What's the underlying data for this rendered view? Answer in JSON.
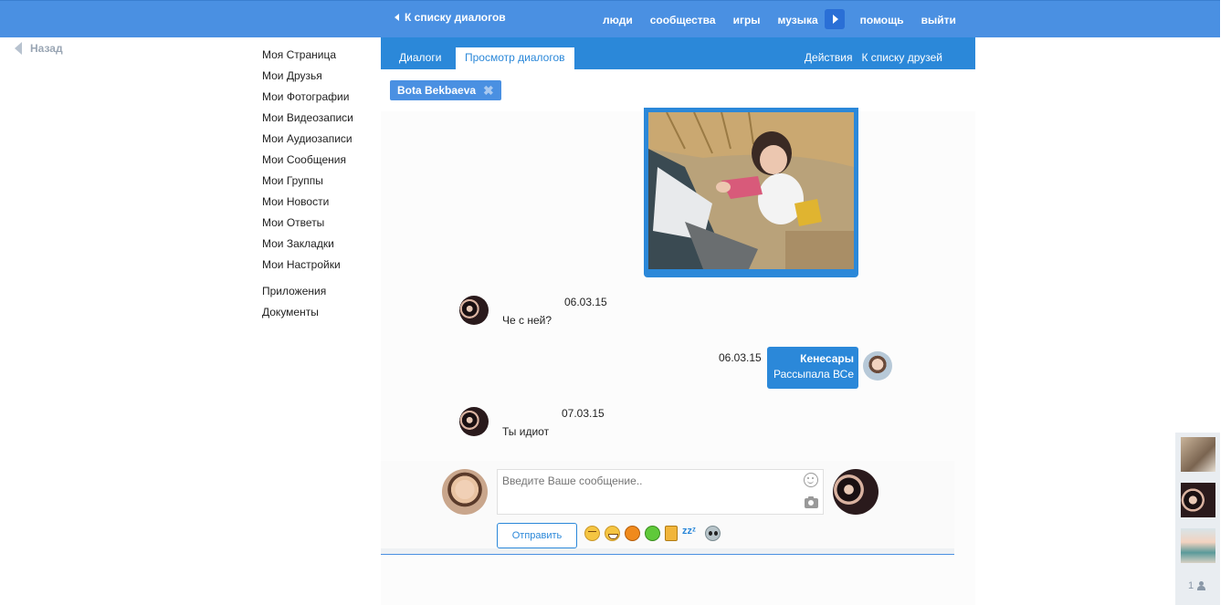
{
  "topbar": {
    "back_label": "К списку диалогов",
    "nav": [
      "люди",
      "сообщества",
      "игры",
      "музыка"
    ],
    "nav_after": [
      "помощь",
      "выйти"
    ]
  },
  "back_link": "Назад",
  "left_menu": {
    "items": [
      "Моя Страница",
      "Мои Друзья",
      "Мои Фотографии",
      "Мои Видеозаписи",
      "Мои Аудиозаписи",
      "Мои Сообщения",
      "Мои Группы",
      "Мои Новости",
      "Мои Ответы",
      "Мои Закладки",
      "Мои Настройки"
    ],
    "extra": [
      "Приложения",
      "Документы"
    ]
  },
  "subbar": {
    "tabs": [
      "Диалоги",
      "Просмотр диалогов"
    ],
    "actions": [
      "Действия",
      "К списку друзей"
    ]
  },
  "chip": {
    "name": "Bota Bekbaeva"
  },
  "messages": [
    {
      "date": "06.03.15",
      "text": "Че с ней?"
    },
    {
      "date": "06.03.15",
      "name": "Кенесары",
      "text": "Рассыпала ВСе"
    },
    {
      "date": "07.03.15",
      "text": "Ты идиот"
    }
  ],
  "compose": {
    "placeholder": "Введите Ваше сообщение..",
    "send_label": "Отправить",
    "emojis": [
      "tired-face-icon",
      "grin-icon",
      "pumpkin-icon",
      "apple-icon",
      "beer-icon",
      "zzz-icon",
      "alien-icon"
    ],
    "zzz": "zzᶻ"
  },
  "right_panel": {
    "count": "1"
  },
  "colors": {
    "accent": "#2b88d9",
    "topbar": "#4a90e2"
  }
}
